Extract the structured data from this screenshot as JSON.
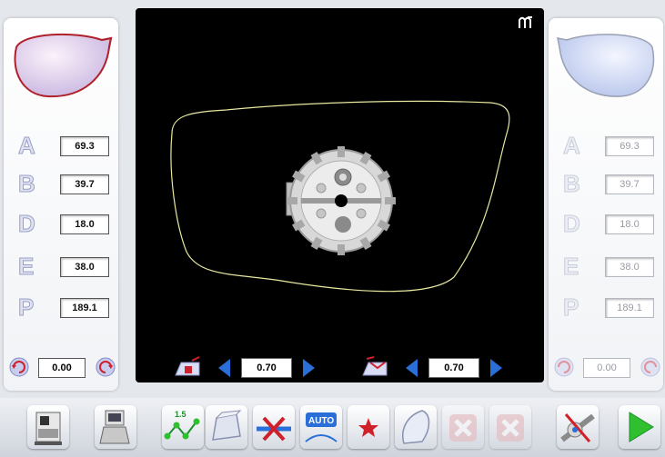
{
  "left_panel": {
    "measurements": [
      {
        "letter": "A",
        "value": "69.3"
      },
      {
        "letter": "B",
        "value": "39.7"
      },
      {
        "letter": "D",
        "value": "18.0"
      },
      {
        "letter": "E",
        "value": "38.0"
      },
      {
        "letter": "P",
        "value": "189.1"
      }
    ],
    "rotation": "0.00"
  },
  "right_panel": {
    "measurements": [
      {
        "letter": "A",
        "value": "69.3"
      },
      {
        "letter": "B",
        "value": "39.7"
      },
      {
        "letter": "D",
        "value": "18.0"
      },
      {
        "letter": "E",
        "value": "38.0"
      },
      {
        "letter": "P",
        "value": "189.1"
      }
    ],
    "rotation": "0.00"
  },
  "viewer": {
    "left_step": "0.70",
    "right_step": "0.70",
    "mode_icon": "wavy-corner-icon"
  },
  "toolbar": {
    "buttons": [
      {
        "icon": "edger-machine-icon",
        "enabled": true
      },
      {
        "icon": "tracer-machine-icon",
        "enabled": true
      },
      {
        "icon": "drill-points-icon",
        "label": "1.5",
        "enabled": true
      },
      {
        "icon": "lens-shape-icon",
        "enabled": true
      },
      {
        "icon": "delete-line-icon",
        "enabled": true
      },
      {
        "icon": "auto-bevel-icon",
        "label": "AUTO",
        "enabled": true
      },
      {
        "icon": "star-icon",
        "enabled": true
      },
      {
        "icon": "lens-edge-icon",
        "enabled": true
      },
      {
        "icon": "cancel-icon",
        "enabled": false
      },
      {
        "icon": "cancel-icon",
        "enabled": false
      },
      {
        "icon": "tool-settings-icon",
        "enabled": true
      },
      {
        "icon": "start-play-icon",
        "enabled": true
      }
    ]
  },
  "colors": {
    "frame_trace": "#e8e8a0",
    "accent_blue": "#2a6fd8",
    "play_green": "#2fbf2f",
    "left_lens_rim": "#b0202a"
  }
}
